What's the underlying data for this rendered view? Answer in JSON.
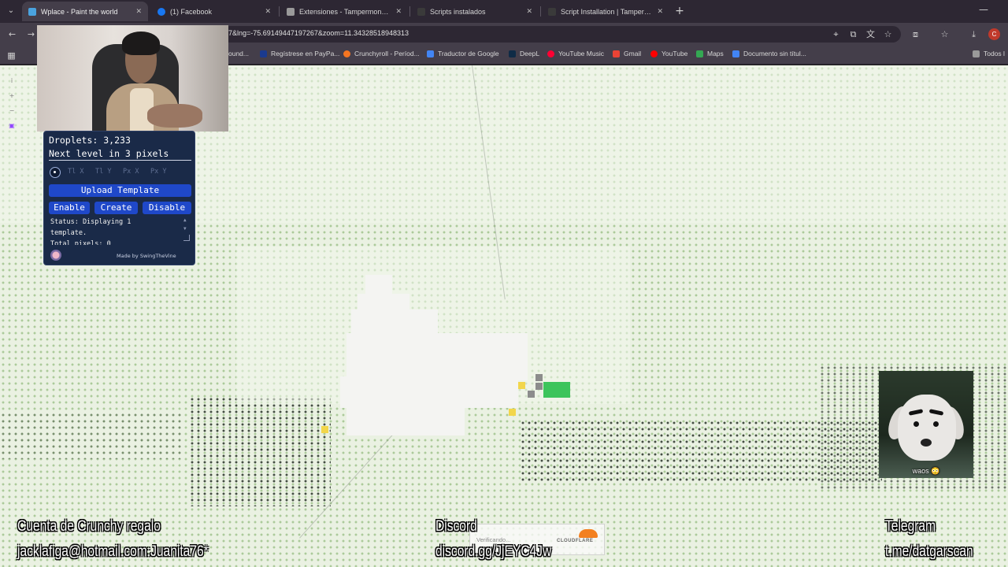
{
  "browser": {
    "tabs": [
      {
        "label": "Wplace - Paint the world",
        "active": true,
        "favicon_color": "#4aa3df"
      },
      {
        "label": "(1) Facebook",
        "active": false,
        "favicon_color": "#1877f2"
      },
      {
        "label": "Extensiones - Tampermonkey",
        "active": false,
        "favicon_color": "#9a9a9a"
      },
      {
        "label": "Scripts instalados",
        "active": false,
        "favicon_color": "#3a3a3a"
      },
      {
        "label": "Script Installation | Tampermon",
        "active": false,
        "favicon_color": "#3a3a3a"
      }
    ],
    "url": "7&lng=-75.69149447197267&zoom=11.34328518948313",
    "profile_initial": "C",
    "bookmarks": [
      {
        "label": "ound...",
        "icon_color": "#e0a030"
      },
      {
        "label": "Regístrese en PayPa...",
        "icon_color": "#1a3a8f"
      },
      {
        "label": "Crunchyroll - Períod...",
        "icon_color": "#f47521"
      },
      {
        "label": "Traductor de Google",
        "icon_color": "#4285f4"
      },
      {
        "label": "DeepL",
        "icon_color": "#0f2b46"
      },
      {
        "label": "YouTube Music",
        "icon_color": "#ff0033"
      },
      {
        "label": "Gmail",
        "icon_color": "#ea4335"
      },
      {
        "label": "YouTube",
        "icon_color": "#ff0000"
      },
      {
        "label": "Maps",
        "icon_color": "#34a853"
      },
      {
        "label": "Documento sin títul...",
        "icon_color": "#4285f4"
      },
      {
        "label": "Todos l",
        "icon_color": "#9a9a9a"
      }
    ]
  },
  "overlay": {
    "droplets_label": "Droplets:",
    "droplets_value": "3,233",
    "next_level_text": "Next level in 3 pixels",
    "coord_placeholders": [
      "Tl X",
      "Tl Y",
      "Px X",
      "Px Y"
    ],
    "upload_label": "Upload Template",
    "enable_label": "Enable",
    "create_label": "Create",
    "disable_label": "Disable",
    "status_lines": [
      "Status: Displaying 1",
      "template.",
      "Total pixels: 0"
    ],
    "credit": "Made by SwingTheVine"
  },
  "sticker_caption": "waos 😳",
  "captions": {
    "crunchy_title": "Cuenta de Crunchy regalo",
    "crunchy_account": "jacklafiga@hotmail.com:Juanita76*",
    "discord_title": "Discord",
    "discord_link": "discord.gg/JjEYC4Jw",
    "telegram_title": "Telegram",
    "telegram_link": "t.me/datgarscan"
  },
  "cloudflare": {
    "status": "Verificando...",
    "brand": "CLOUDFLARE"
  },
  "colors": {
    "overlay_bg": "#1a2a48",
    "button_blue": "#1f48c9",
    "map_bg": "#eaf1e2",
    "pixel_yellow": "#f2d64b",
    "pixel_green": "#3cc45b",
    "pixel_gray": "#8c8c8c"
  }
}
